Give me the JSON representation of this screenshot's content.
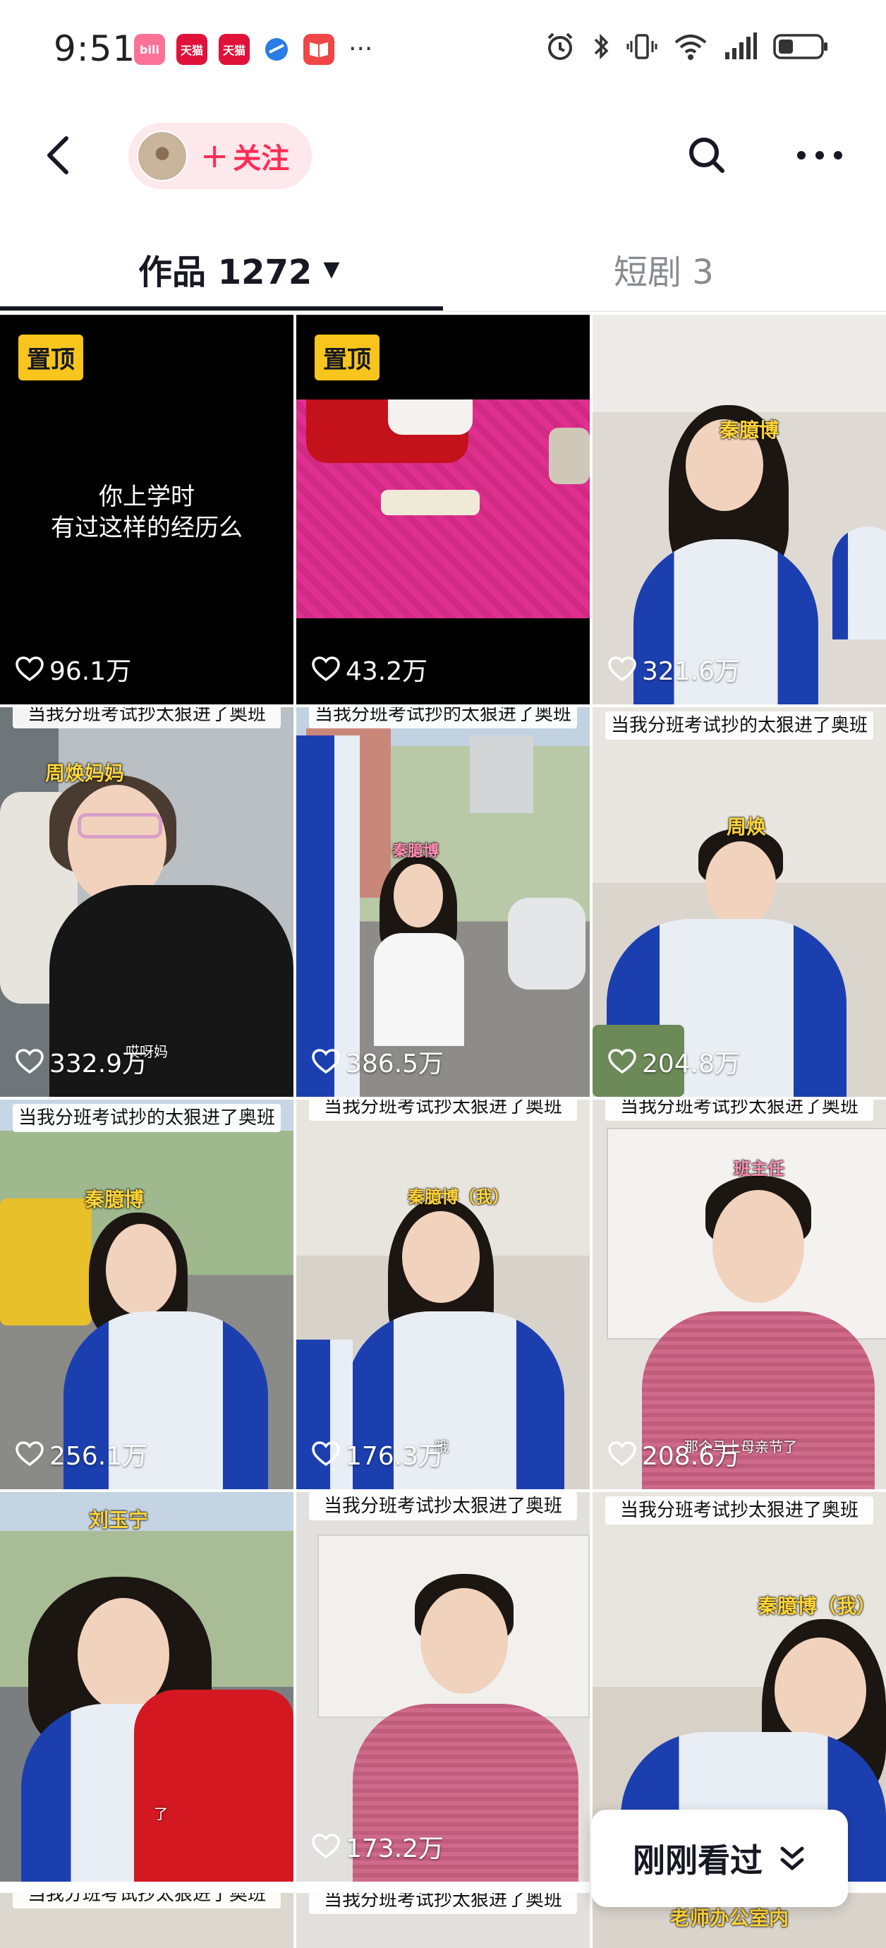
{
  "status_bar": {
    "time": "9:51",
    "more": "···",
    "app_icons": [
      {
        "name": "bilibili-icon",
        "color": "#fb7299",
        "label": "bili"
      },
      {
        "name": "tmall-icon-1",
        "color": "#e0123a",
        "label": "天猫"
      },
      {
        "name": "tmall-icon-2",
        "color": "#e0123a",
        "label": "天猫"
      },
      {
        "name": "browser-icon",
        "color": "#2a7ce6",
        "label": ""
      },
      {
        "name": "book-app-icon",
        "color": "#f04646",
        "label": ""
      }
    ]
  },
  "header": {
    "follow_plus": "+",
    "follow_label": "关注"
  },
  "tabs": {
    "works_label": "作品 1272",
    "works_caret": "▼",
    "drama_label": "短剧 3"
  },
  "grid": [
    {
      "pinned": true,
      "pin_label": "置顶",
      "caption_line1": "你上学时",
      "caption_line2": "有过这样的经历么",
      "likes": "96.1万",
      "title": "",
      "name": "",
      "subtitle": "",
      "bg": "#000000"
    },
    {
      "pinned": true,
      "pin_label": "置顶",
      "likes": "43.2万",
      "title": "",
      "name": "",
      "subtitle": "",
      "bg": "#000000"
    },
    {
      "pinned": false,
      "likes": "321.6万",
      "title": "",
      "name": "秦臆博",
      "subtitle": "",
      "bg": "#e8e6e2"
    },
    {
      "pinned": false,
      "likes": "332.9万",
      "title": "当我分班考试抄太狠进了奥班",
      "name": "周焕妈妈",
      "subtitle": "哎呀妈",
      "bg": "#9aa3a8"
    },
    {
      "pinned": false,
      "likes": "386.5万",
      "title": "当我分班考试抄的太狠进了奥班",
      "name": "秦臆博",
      "subtitle": "",
      "bg": "#b9c9a8"
    },
    {
      "pinned": false,
      "likes": "204.8万",
      "title": "当我分班考试抄的太狠进了奥班",
      "name": "周焕",
      "subtitle": "",
      "bg": "#e6e2dc"
    },
    {
      "pinned": false,
      "likes": "256.1万",
      "title": "当我分班考试抄的太狠进了奥班",
      "name": "秦臆博",
      "subtitle": "",
      "bg": "#a6b89a"
    },
    {
      "pinned": false,
      "likes": "176.3万",
      "title": "当我分班考试抄太狠进了奥班",
      "name": "秦臆博（我）",
      "subtitle": "哦",
      "bg": "#e3dfd8"
    },
    {
      "pinned": false,
      "likes": "208.6万",
      "title": "当我分班考试抄太狠进了奥班",
      "name": "班主任",
      "subtitle": "那个马上母亲节了",
      "bg": "#e4e1dc"
    },
    {
      "pinned": false,
      "likes": "",
      "title": "",
      "name": "刘玉宁",
      "subtitle": "了",
      "bg": "#b7c4ae"
    },
    {
      "pinned": false,
      "likes": "173.2万",
      "title": "当我分班考试抄太狠进了奥班",
      "name": "",
      "subtitle": "",
      "bg": "#e2e0dc"
    },
    {
      "pinned": false,
      "likes": "",
      "title": "当我分班考试抄太狠进了奥班",
      "name": "秦臆博（我）",
      "subtitle": "",
      "bg": "#e6e2dc"
    }
  ],
  "partial_row": [
    {
      "title": "当我分班考试抄太狠进了奥班"
    },
    {
      "title": "当我分班考试抄太狠进了奥班"
    },
    {
      "title": "老师办公室内"
    }
  ],
  "recent_button": {
    "label": "刚刚看过"
  }
}
